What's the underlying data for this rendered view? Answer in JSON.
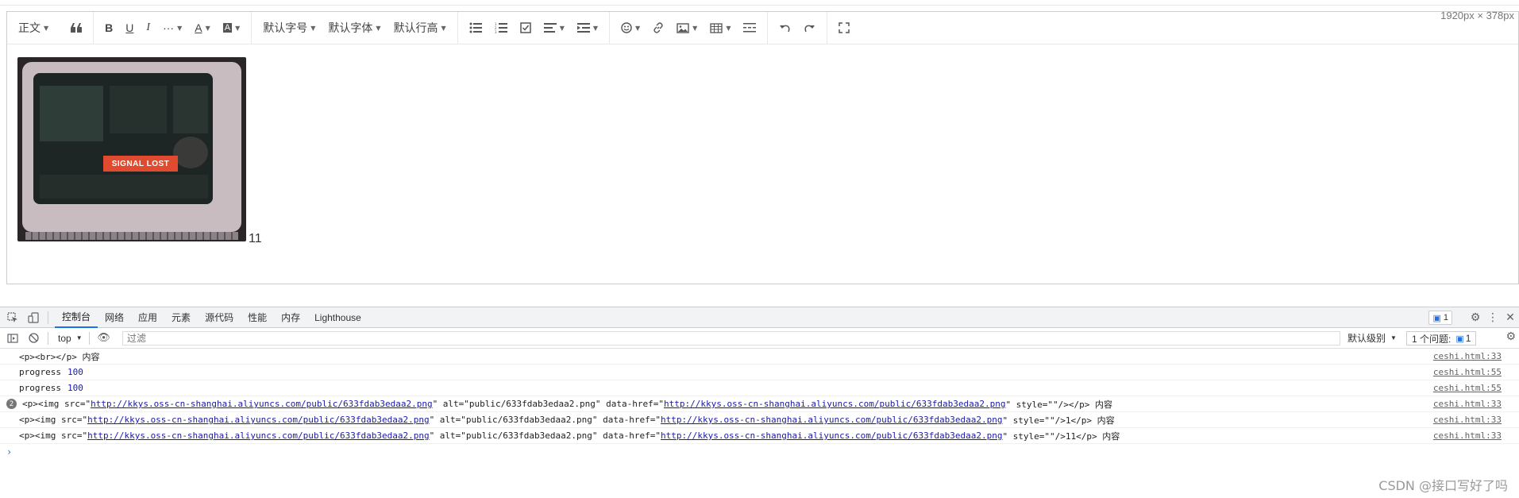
{
  "page": {
    "dims_label": "1920px × 378px",
    "watermark": "CSDN @接口写好了吗"
  },
  "editor": {
    "toolbar": {
      "heading": "正文",
      "quote_icon": "quote-icon",
      "bold": "B",
      "underline": "U",
      "italic": "I",
      "more": "···",
      "font_color": "A",
      "bg_color": "A",
      "font_size": "默认字号",
      "font_family": "默认字体",
      "line_height": "默认行高",
      "icons": [
        "bullet-list-icon",
        "numbered-list-icon",
        "todo-icon",
        "justify-icon",
        "indent-icon",
        "emoji-icon",
        "link-icon",
        "image-icon",
        "table-icon",
        "divider-icon",
        "undo-icon",
        "redo-icon",
        "fullscreen-icon"
      ]
    },
    "content": {
      "image_text": "SIGNAL LOST",
      "after_text": "11"
    }
  },
  "devtools": {
    "tabs": [
      "控制台",
      "网络",
      "应用",
      "元素",
      "源代码",
      "性能",
      "内存",
      "Lighthouse"
    ],
    "active_tab": "控制台",
    "issue_badge": "1",
    "context": "top",
    "filter_placeholder": "过滤",
    "levels": "默认级别",
    "issues_label": "1 个问题:",
    "issues_count": "1",
    "logs": [
      {
        "text": "<p><br></p> 内容",
        "source": "ceshi.html:33"
      },
      {
        "label": "progress",
        "value": "100",
        "source": "ceshi.html:55"
      },
      {
        "label": "progress",
        "value": "100",
        "source": "ceshi.html:55"
      },
      {
        "repeat": "2",
        "pre": "<p><img src=\"",
        "url": "http://kkys.oss-cn-shanghai.aliyuncs.com/public/633fdab3edaa2.png",
        "mid": "\" alt=\"public/633fdab3edaa2.png\" data-href=\"",
        "url2": "http://kkys.oss-cn-shanghai.aliyuncs.com/public/633fdab3edaa2.png",
        "post": "\" style=\"\"/></p> 内容",
        "source": "ceshi.html:33"
      },
      {
        "pre": "<p><img src=\"",
        "url": "http://kkys.oss-cn-shanghai.aliyuncs.com/public/633fdab3edaa2.png",
        "mid": "\" alt=\"public/633fdab3edaa2.png\" data-href=\"",
        "url2": "http://kkys.oss-cn-shanghai.aliyuncs.com/public/633fdab3edaa2.png",
        "post": "\" style=\"\"/>1</p> 内容",
        "source": "ceshi.html:33"
      },
      {
        "pre": "<p><img src=\"",
        "url": "http://kkys.oss-cn-shanghai.aliyuncs.com/public/633fdab3edaa2.png",
        "mid": "\" alt=\"public/633fdab3edaa2.png\" data-href=\"",
        "url2": "http://kkys.oss-cn-shanghai.aliyuncs.com/public/633fdab3edaa2.png",
        "post": "\" style=\"\"/>11</p> 内容",
        "source": "ceshi.html:33"
      }
    ],
    "prompt": "›"
  }
}
